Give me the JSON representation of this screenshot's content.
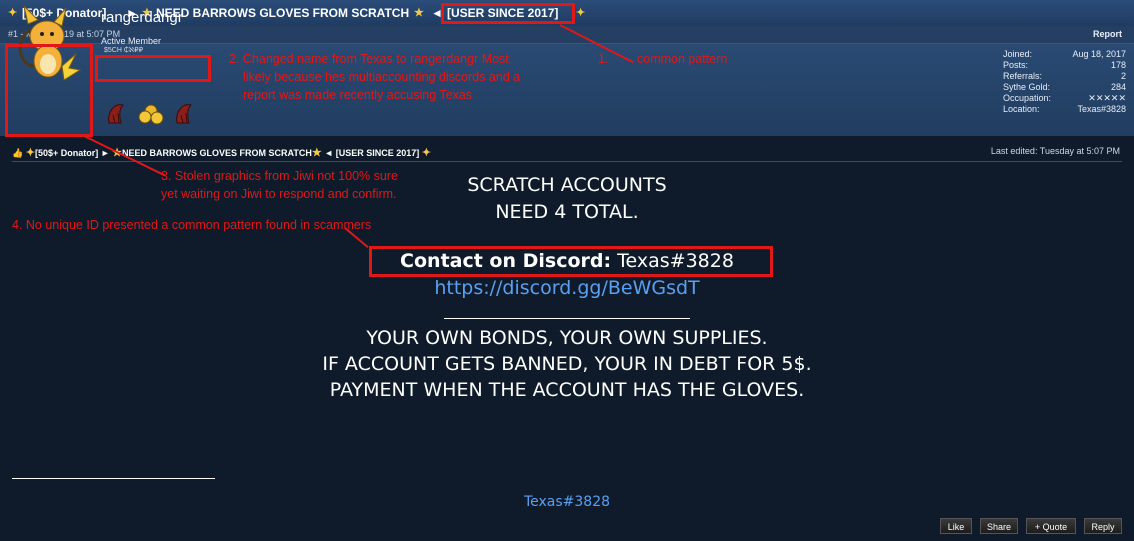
{
  "header": {
    "title_prefix": "[50$+ Donator]",
    "arrow": "►",
    "title_main": "NEED BARROWS GLOVES FROM SCRATCH",
    "back_arrow": "◄",
    "user_since": "[USER SINCE 2017]"
  },
  "meta": {
    "post_info": "#1 - Mar 5, 2019 at 5:07 PM",
    "report": "Report"
  },
  "user": {
    "name": "rangerdangr",
    "title": "Active Member",
    "awards_caption": "$5CH   ₵ℵ₽₽"
  },
  "stats": [
    {
      "label": "Joined:",
      "value": "Aug 18, 2017"
    },
    {
      "label": "Posts:",
      "value": "178"
    },
    {
      "label": "Referrals:",
      "value": "2"
    },
    {
      "label": "Sythe Gold:",
      "value": "284"
    },
    {
      "label": "Occupation:",
      "value": "✕✕✕✕✕"
    },
    {
      "label": "Location:",
      "value": "Texas#3828"
    }
  ],
  "annotations": {
    "a1_num": "1.",
    "a1_text": "common pattern",
    "a2_line1": "2. Changed name from Texas to rangerdangr Most",
    "a2_line2": "likely because hes multiaccounting discords and a",
    "a2_line3": "report was made recently accusing Texas",
    "a3_line1": "3. Stolen graphics from Jiwi not 100% sure",
    "a3_line2": "yet waiting on Jiwi to respond and confirm.",
    "a4": "4. No unique ID presented a common pattern found in scammers"
  },
  "signature_line": {
    "prefix": "[50$+ Donator]",
    "arrow": "►",
    "main": "NEED BARROWS GLOVES FROM SCRATCH",
    "back_arrow": "◄",
    "since": "[USER SINCE 2017]"
  },
  "last_edited": "Last edited: Tuesday at 5:07 PM",
  "post_body": {
    "line1": "SCRATCH ACCOUNTS",
    "line2": "NEED 4 TOTAL.",
    "contact_label": "Contact on Discord:",
    "contact_value": "Texas#3828",
    "discord_link": "https://discord.gg/BeWGsdT",
    "line3": "YOUR OWN BONDS, YOUR OWN SUPPLIES.",
    "line4": "IF ACCOUNT GETS BANNED, YOUR IN DEBT FOR 5$.",
    "line5": "PAYMENT WHEN THE ACCOUNT HAS THE GLOVES."
  },
  "signature_id": "Texas#3828",
  "buttons": {
    "like": "Like",
    "share": "Share",
    "quote": "+ Quote",
    "reply": "Reply"
  },
  "colors": {
    "annotation_red": "#e01818",
    "background": "#0f1b2b",
    "link_blue": "#5aa0f0"
  }
}
